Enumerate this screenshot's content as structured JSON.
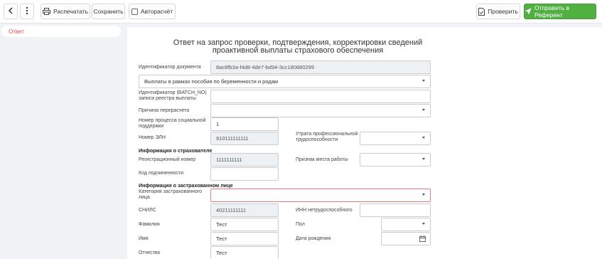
{
  "toolbar": {
    "back_icon": "chevron-left-icon",
    "more_icon": "kebab-icon",
    "print_label": "Распечатать",
    "save_label": "Сохранить",
    "autocalc_label": "Авторасчёт",
    "check_label": "Проверить",
    "send_label": "Отправить в Референт"
  },
  "sidebar": {
    "items": [
      {
        "label": "Ответ",
        "active": true
      }
    ]
  },
  "form": {
    "title_line1": "Ответ на запрос проверки, подтверждения, корректировки сведений",
    "title_line2": "проактивной выплаты страхового обеспечения",
    "doc_id_label": "Идентификатор документа",
    "doc_id_value": "8ac8fb3a-f4d8-4de7-bd94-3cc180880299",
    "payment_type_value": "Выплаты в рамках пособия по беременности и родам",
    "batch_label_1": "Идентификатор (BATCH_NO)",
    "batch_label_2": "записи реестра выплаты",
    "batch_value": "",
    "recalc_label": "Причина перерасчета",
    "recalc_value": "",
    "process_label_1": "Номер процесса социальной",
    "process_label_2": "поддержки",
    "process_value": "1",
    "eln_label": "Номер ЭЛН",
    "eln_value": "910111111111",
    "loss_label_1": "Утрата профессиональной",
    "loss_label_2": "трудоспособности",
    "loss_value": "",
    "insurer_section": "Информация о страхователе",
    "reg_label": "Регистрационный номер",
    "reg_value": "1111111111",
    "workplace_label": "Признак места работы",
    "workplace_value": "",
    "subcode_label": "Код подчиненности",
    "subcode_value": "",
    "insured_section": "Информация о застрахованном лице",
    "category_label_1": "Категория застрахованного",
    "category_label_2": "лица",
    "category_value": "",
    "snils_label": "СНИЛС",
    "snils_value": "40211111111",
    "inn_label": "ИНН нетрудоспособного",
    "inn_value": "",
    "surname_label": "Фамилия",
    "surname_value": "Тест",
    "sex_label": "Пол",
    "sex_value": "",
    "name_label": "Имя",
    "name_value": "Тест",
    "birth_label": "Дата рождения",
    "birth_value": "",
    "patronymic_label": "Отчество",
    "patronymic_value": "Тест"
  },
  "colors": {
    "accent_green": "#52b043",
    "active_red": "#e04b4b",
    "readonly_bg": "#eef1f4",
    "error_border": "#e07c7c"
  }
}
